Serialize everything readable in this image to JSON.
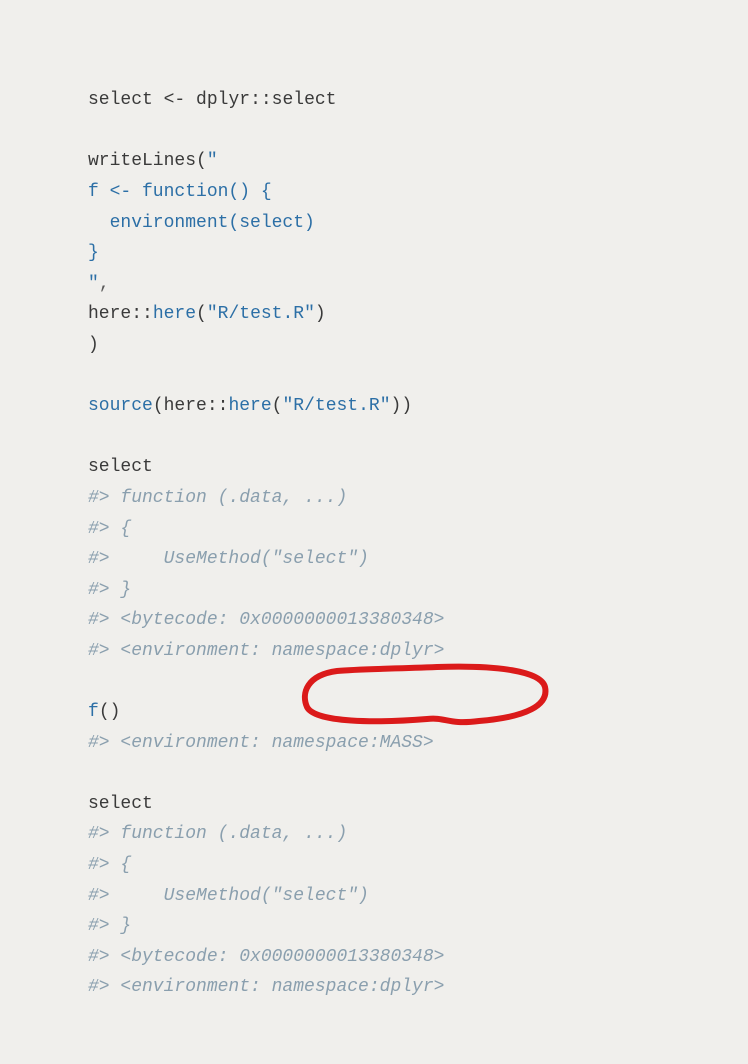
{
  "code": {
    "lines": [
      {
        "type": "code",
        "tokens": [
          {
            "t": "select",
            "c": "ident"
          },
          {
            "t": " ",
            "c": "sp"
          },
          {
            "t": "<-",
            "c": "assign"
          },
          {
            "t": " ",
            "c": "sp"
          },
          {
            "t": "dplyr",
            "c": "ident"
          },
          {
            "t": "::",
            "c": "ns-op"
          },
          {
            "t": "select",
            "c": "ident"
          }
        ]
      },
      {
        "type": "blank"
      },
      {
        "type": "code",
        "tokens": [
          {
            "t": "writeLines",
            "c": "ident"
          },
          {
            "t": "(",
            "c": "paren"
          },
          {
            "t": "\"",
            "c": "string"
          }
        ]
      },
      {
        "type": "code",
        "tokens": [
          {
            "t": "f <- function() {",
            "c": "string"
          }
        ]
      },
      {
        "type": "code",
        "tokens": [
          {
            "t": "  environment(select)",
            "c": "string"
          }
        ]
      },
      {
        "type": "code",
        "tokens": [
          {
            "t": "}",
            "c": "string"
          }
        ]
      },
      {
        "type": "code",
        "tokens": [
          {
            "t": "\"",
            "c": "string"
          },
          {
            "t": ",",
            "c": "op"
          }
        ]
      },
      {
        "type": "code",
        "tokens": [
          {
            "t": "here",
            "c": "ident"
          },
          {
            "t": "::",
            "c": "ns-op"
          },
          {
            "t": "here",
            "c": "func"
          },
          {
            "t": "(",
            "c": "paren"
          },
          {
            "t": "\"R/test.R\"",
            "c": "string"
          },
          {
            "t": ")",
            "c": "paren"
          }
        ]
      },
      {
        "type": "code",
        "tokens": [
          {
            "t": ")",
            "c": "paren"
          }
        ]
      },
      {
        "type": "blank"
      },
      {
        "type": "code",
        "tokens": [
          {
            "t": "source",
            "c": "func"
          },
          {
            "t": "(",
            "c": "paren"
          },
          {
            "t": "here",
            "c": "ident"
          },
          {
            "t": "::",
            "c": "ns-op"
          },
          {
            "t": "here",
            "c": "func"
          },
          {
            "t": "(",
            "c": "paren"
          },
          {
            "t": "\"R/test.R\"",
            "c": "string"
          },
          {
            "t": ")",
            "c": "paren"
          },
          {
            "t": ")",
            "c": "paren"
          }
        ]
      },
      {
        "type": "blank"
      },
      {
        "type": "code",
        "tokens": [
          {
            "t": "select",
            "c": "ident"
          }
        ]
      },
      {
        "type": "comment",
        "text": "#> function (.data, ...)"
      },
      {
        "type": "comment",
        "text": "#> {"
      },
      {
        "type": "comment",
        "text": "#>     UseMethod(\"select\")"
      },
      {
        "type": "comment",
        "text": "#> }"
      },
      {
        "type": "comment",
        "text": "#> <bytecode: 0x0000000013380348>"
      },
      {
        "type": "comment",
        "text": "#> <environment: namespace:dplyr>"
      },
      {
        "type": "blank"
      },
      {
        "type": "code",
        "tokens": [
          {
            "t": "f",
            "c": "func"
          },
          {
            "t": "()",
            "c": "paren"
          }
        ]
      },
      {
        "type": "comment",
        "text": "#> <environment: namespace:MASS>"
      },
      {
        "type": "blank"
      },
      {
        "type": "code",
        "tokens": [
          {
            "t": "select",
            "c": "ident"
          }
        ]
      },
      {
        "type": "comment",
        "text": "#> function (.data, ...)"
      },
      {
        "type": "comment",
        "text": "#> {"
      },
      {
        "type": "comment",
        "text": "#>     UseMethod(\"select\")"
      },
      {
        "type": "comment",
        "text": "#> }"
      },
      {
        "type": "comment",
        "text": "#> <bytecode: 0x0000000013380348>"
      },
      {
        "type": "comment",
        "text": "#> <environment: namespace:dplyr>"
      }
    ]
  },
  "annotation": {
    "color": "#db1a1a",
    "highlighted_text": "namespace:MASS"
  }
}
